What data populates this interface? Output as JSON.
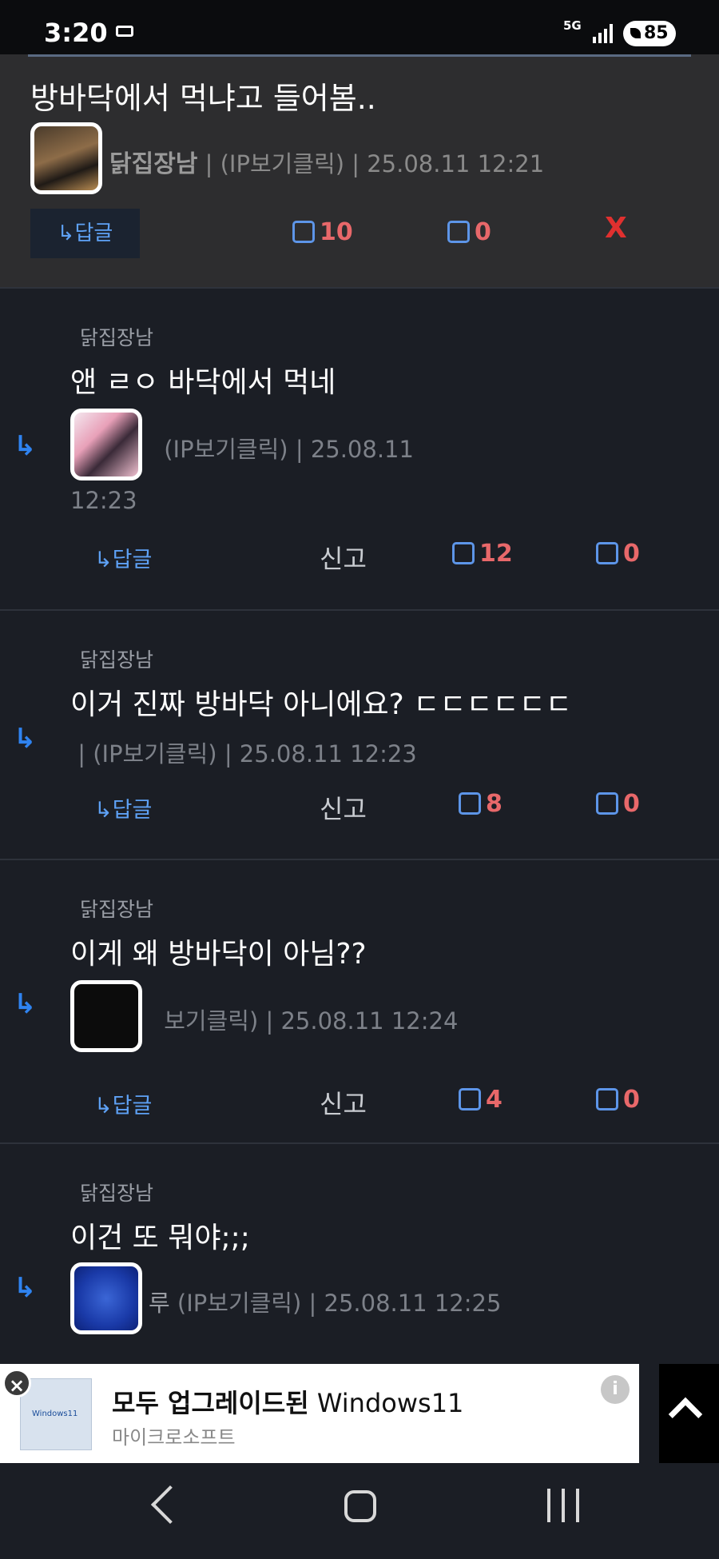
{
  "status_bar": {
    "time": "3:20",
    "network": "5G",
    "battery": "85"
  },
  "top_comment": {
    "text": "방바닥에서 먹냐고 들어봄..",
    "author": "닭집장남",
    "meta": "| (IP보기클릭) | 25.08.11 12:21",
    "reply_label": "↳답글",
    "likes": "10",
    "dislikes": "0",
    "delete_label": "X"
  },
  "replies": [
    {
      "reply_to": "닭집장남",
      "text": "앤 ㄹㅇ 바닥에서 먹네",
      "author": "",
      "meta": "(IP보기클릭) | 25.08.11",
      "meta_wrap": "12:23",
      "reply_label": "↳답글",
      "report_label": "신고",
      "likes": "12",
      "dislikes": "0"
    },
    {
      "reply_to": "닭집장남",
      "text": "이거 진짜 방바닥 아니에요? ㄷㄷㄷㄷㄷㄷ",
      "author": "",
      "meta": "| (IP보기클릭) | 25.08.11 12:23",
      "reply_label": "↳답글",
      "report_label": "신고",
      "likes": "8",
      "dislikes": "0"
    },
    {
      "reply_to": "닭집장남",
      "text": "이게 왜 방바닥이 아님??",
      "author": "",
      "meta": "보기클릭) | 25.08.11 12:24",
      "reply_label": "↳답글",
      "report_label": "신고",
      "likes": "4",
      "dislikes": "0"
    },
    {
      "reply_to": "닭집장남",
      "text": "이건 또 뭐야;;;",
      "author": "루",
      "meta": "(IP보기클릭) | 25.08.11 12:25"
    }
  ],
  "ad": {
    "title_bold": "모두 업그레이드된",
    "title_rest": "Windows11",
    "advertiser": "마이크로소프트",
    "thumb_label": "Windows11"
  },
  "colors": {
    "background": "#1b1e25",
    "accent_blue": "#5ea1f5",
    "vote_red": "#e8686a",
    "delete_red": "#e0302f"
  }
}
